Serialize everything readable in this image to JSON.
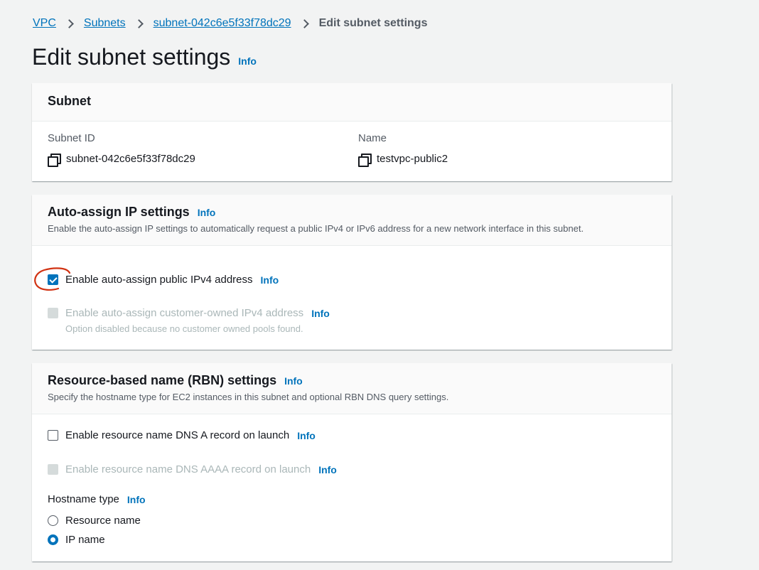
{
  "breadcrumb": {
    "items": [
      "VPC",
      "Subnets",
      "subnet-042c6e5f33f78dc29"
    ],
    "current": "Edit subnet settings"
  },
  "page": {
    "title": "Edit subnet settings",
    "info": "Info"
  },
  "subnet_panel": {
    "title": "Subnet",
    "subnet_id_label": "Subnet ID",
    "subnet_id_value": "subnet-042c6e5f33f78dc29",
    "name_label": "Name",
    "name_value": "testvpc-public2"
  },
  "autoassign_panel": {
    "title": "Auto-assign IP settings",
    "info": "Info",
    "description": "Enable the auto-assign IP settings to automatically request a public IPv4 or IPv6 address for a new network interface in this subnet.",
    "ipv4_label": "Enable auto-assign public IPv4 address",
    "ipv4_checked": true,
    "customer_owned_label": "Enable auto-assign customer-owned IPv4 address",
    "customer_owned_hint": "Option disabled because no customer owned pools found."
  },
  "rbn_panel": {
    "title": "Resource-based name (RBN) settings",
    "info": "Info",
    "description": "Specify the hostname type for EC2 instances in this subnet and optional RBN DNS query settings.",
    "dns_a_label": "Enable resource name DNS A record on launch",
    "dns_aaaa_label": "Enable resource name DNS AAAA record on launch",
    "hostname_type_label": "Hostname type",
    "hostname_options": [
      "Resource name",
      "IP name"
    ],
    "hostname_selected": "IP name"
  },
  "colors": {
    "link": "#0073bb",
    "annotation": "#d13212"
  }
}
